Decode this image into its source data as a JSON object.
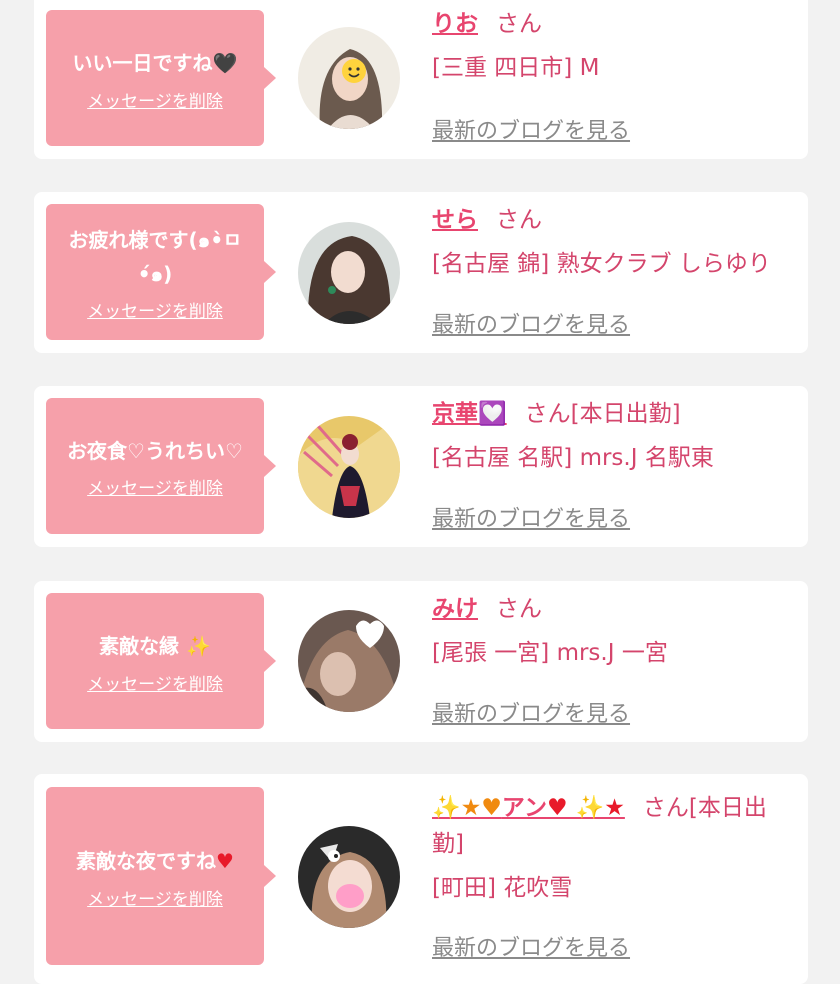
{
  "entries": [
    {
      "message": "いい一日ですね",
      "message_emoji": "🖤",
      "delete_label": "メッセージを削除",
      "name": "りお",
      "suffix": "さん",
      "shop": "[三重 四日市] M",
      "blog_label": "最新のブログを見る"
    },
    {
      "message": "お疲れ様です(๑•̀ㅁ•́๑)",
      "delete_label": "メッセージを削除",
      "name": "せら",
      "suffix": "さん",
      "shop": "[名古屋 錦] 熟女クラブ しらゆり",
      "blog_label": "最新のブログを見る"
    },
    {
      "message": "お夜食♡うれちい♡",
      "delete_label": "メッセージを削除",
      "name": "京華",
      "name_emoji": "💟",
      "suffix": "さん[本日出勤]",
      "shop": "[名古屋 名駅] mrs.J 名駅東",
      "blog_label": "最新のブログを見る"
    },
    {
      "message": "素敵な縁",
      "message_emoji": "✨",
      "delete_label": "メッセージを削除",
      "name": "みけ",
      "suffix": "さん",
      "shop": "[尾張 一宮] mrs.J 一宮",
      "blog_label": "最新のブログを見る"
    },
    {
      "message": "素敵な夜ですね",
      "message_emoji": "♥",
      "delete_label": "メッセージを削除",
      "name_prefix": "✨★♥",
      "name": "アン",
      "name_suffix_emoji": "♥ ✨★",
      "suffix": "さん[本日出勤]",
      "shop": "[町田] 花吹雪",
      "blog_label": "最新のブログを見る"
    }
  ],
  "colors": {
    "bubble": "#f6a0aa",
    "name": "#e8456f",
    "text": "#d4456c",
    "link_gray": "#8a8a8a",
    "background": "#f2f2f2"
  },
  "icons": [
    "black-heart-icon",
    "sparkle-icon",
    "red-heart-icon",
    "star-icon",
    "heart-decoration-icon"
  ]
}
